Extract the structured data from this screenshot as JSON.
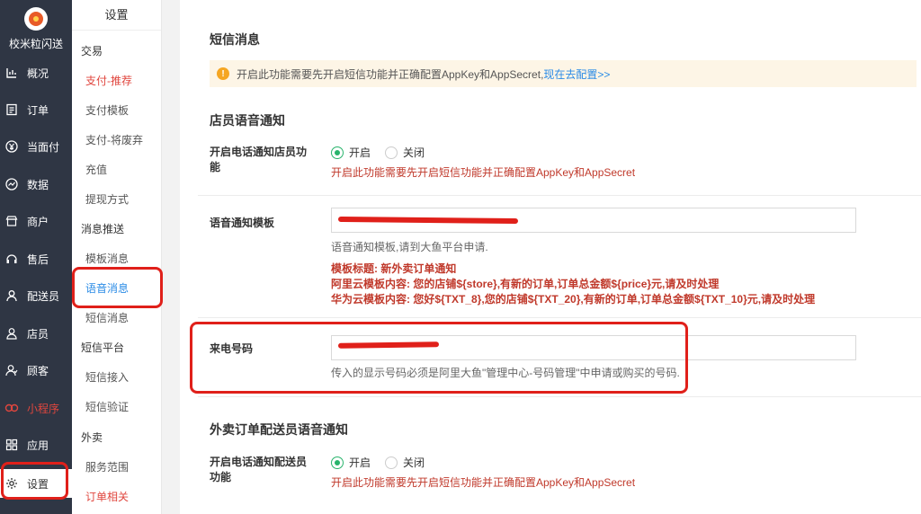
{
  "app": {
    "name": "校米粒闪送"
  },
  "sidebar": {
    "items": [
      {
        "label": "概况",
        "icon": "dashboard-icon"
      },
      {
        "label": "订单",
        "icon": "order-icon"
      },
      {
        "label": "当面付",
        "icon": "yuan-icon"
      },
      {
        "label": "数据",
        "icon": "chart-icon"
      },
      {
        "label": "商户",
        "icon": "store-icon"
      },
      {
        "label": "售后",
        "icon": "aftersale-icon"
      },
      {
        "label": "配送员",
        "icon": "courier-icon"
      },
      {
        "label": "店员",
        "icon": "staff-icon"
      },
      {
        "label": "顾客",
        "icon": "customer-icon"
      },
      {
        "label": "小程序",
        "icon": "miniprogram-icon"
      },
      {
        "label": "应用",
        "icon": "apps-icon"
      },
      {
        "label": "设置",
        "icon": "gear-icon"
      }
    ]
  },
  "submenu": {
    "title": "设置",
    "items": [
      {
        "label": "交易"
      },
      {
        "label": "支付-推荐"
      },
      {
        "label": "支付模板"
      },
      {
        "label": "支付-将废弃"
      },
      {
        "label": "充值"
      },
      {
        "label": "提现方式"
      },
      {
        "label": "消息推送"
      },
      {
        "label": "模板消息"
      },
      {
        "label": "语音消息"
      },
      {
        "label": "短信消息"
      },
      {
        "label": "短信平台"
      },
      {
        "label": "短信接入"
      },
      {
        "label": "短信验证"
      },
      {
        "label": "外卖"
      },
      {
        "label": "服务范围"
      },
      {
        "label": "订单相关"
      }
    ]
  },
  "main": {
    "sms_title": "短信消息",
    "alert": {
      "text": "开启此功能需要先开启短信功能并正确配置AppKey和AppSecret,",
      "link": "现在去配置>>"
    },
    "staff_voice": {
      "title": "店员语音通知",
      "enable_label": "开启电话通知店员功能",
      "on_label": "开启",
      "off_label": "关闭",
      "hint": "开启此功能需要先开启短信功能并正确配置AppKey和AppSecret"
    },
    "voice_template": {
      "label": "语音通知模板",
      "value": "",
      "hint": "语音通知模板,请到大鱼平台申请.",
      "lines": [
        "模板标题: 新外卖订单通知",
        "阿里云模板内容: 您的店铺${store},有新的订单,订单总金额${price}元,请及时处理",
        "华为云模板内容: 您好${TXT_8},您的店铺${TXT_20},有新的订单,订单总金额${TXT_10}元,请及时处理"
      ]
    },
    "caller_number": {
      "label": "来电号码",
      "value": "",
      "hint": "传入的显示号码必须是阿里大鱼\"管理中心-号码管理\"中申请或购买的号码."
    },
    "courier_voice": {
      "title": "外卖订单配送员语音通知",
      "enable_label": "开启电话通知配送员功能",
      "on_label": "开启",
      "off_label": "关闭",
      "hint": "开启此功能需要先开启短信功能并正确配置AppKey和AppSecret"
    }
  },
  "colors": {
    "accent_red": "#e0463e",
    "link_blue": "#2a8be6",
    "radio_green": "#27b36b",
    "annotation_red": "#e0201a"
  }
}
